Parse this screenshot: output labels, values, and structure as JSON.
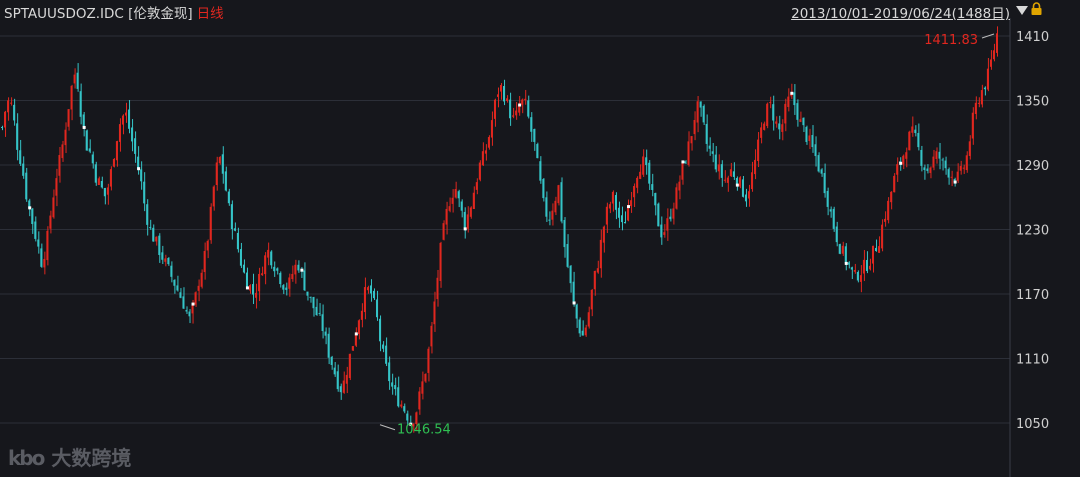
{
  "header": {
    "symbol": "SPTAUUSDOZ.IDC [伦敦金现]",
    "period": "日线",
    "date_range": "2013/10/01-2019/06/24(1488日)"
  },
  "watermark": {
    "logo": "kbo",
    "text": "大数跨境"
  },
  "icons": {
    "dropdown": "triangle-down-icon",
    "lock": "lock-icon"
  },
  "colors": {
    "background": "#16171c",
    "up": "#e0271f",
    "down": "#35c4c7",
    "grid": "#2c2f38",
    "axis_text": "#d0d0d0",
    "high_label": "#e0271f",
    "low_label": "#2fbf52"
  },
  "chart_data": {
    "type": "candlestick",
    "title": "",
    "x": [
      "2013/10/01",
      "2019/06/24"
    ],
    "ylim": [
      1020,
      1420
    ],
    "y_ticks": [
      1410,
      1350,
      1290,
      1230,
      1170,
      1110,
      1050
    ],
    "grid": true,
    "annotations": [
      {
        "label": "1411.83",
        "value": 1411.83,
        "type": "high"
      },
      {
        "label": "1046.54",
        "value": 1046.54,
        "type": "low"
      }
    ],
    "series": [
      {
        "values": [
          1325,
          1350,
          1345,
          1310,
          1290,
          1260,
          1240,
          1220,
          1200,
          1215,
          1250,
          1280,
          1300,
          1330,
          1360,
          1380,
          1340,
          1310,
          1300,
          1280,
          1270,
          1260,
          1280,
          1310,
          1330,
          1340,
          1320,
          1300,
          1280,
          1250,
          1230,
          1220,
          1210,
          1200,
          1190,
          1180,
          1170,
          1160,
          1145,
          1160,
          1185,
          1200,
          1230,
          1270,
          1300,
          1280,
          1250,
          1230,
          1210,
          1190,
          1180,
          1170,
          1180,
          1200,
          1210,
          1200,
          1190,
          1180,
          1175,
          1190,
          1200,
          1185,
          1170,
          1160,
          1150,
          1140,
          1120,
          1105,
          1090,
          1080,
          1100,
          1120,
          1140,
          1160,
          1175,
          1170,
          1150,
          1120,
          1100,
          1085,
          1075,
          1068,
          1060,
          1050,
          1060,
          1080,
          1100,
          1130,
          1170,
          1210,
          1240,
          1260,
          1270,
          1250,
          1235,
          1250,
          1270,
          1290,
          1300,
          1320,
          1345,
          1365,
          1355,
          1340,
          1330,
          1345,
          1350,
          1330,
          1310,
          1280,
          1250,
          1240,
          1255,
          1270,
          1220,
          1190,
          1160,
          1140,
          1130,
          1150,
          1180,
          1200,
          1230,
          1250,
          1260,
          1245,
          1230,
          1250,
          1270,
          1285,
          1295,
          1280,
          1260,
          1240,
          1225,
          1235,
          1250,
          1265,
          1285,
          1300,
          1320,
          1345,
          1335,
          1310,
          1300,
          1290,
          1280,
          1275,
          1285,
          1280,
          1270,
          1260,
          1275,
          1295,
          1320,
          1340,
          1345,
          1330,
          1320,
          1340,
          1355,
          1345,
          1330,
          1320,
          1310,
          1300,
          1285,
          1270,
          1250,
          1230,
          1215,
          1205,
          1195,
          1185,
          1190,
          1195,
          1200,
          1210,
          1220,
          1240,
          1255,
          1275,
          1290,
          1300,
          1315,
          1320,
          1305,
          1290,
          1285,
          1295,
          1300,
          1290,
          1285,
          1280,
          1278,
          1285,
          1300,
          1330,
          1350,
          1360,
          1370,
          1390,
          1411.83
        ]
      }
    ]
  }
}
